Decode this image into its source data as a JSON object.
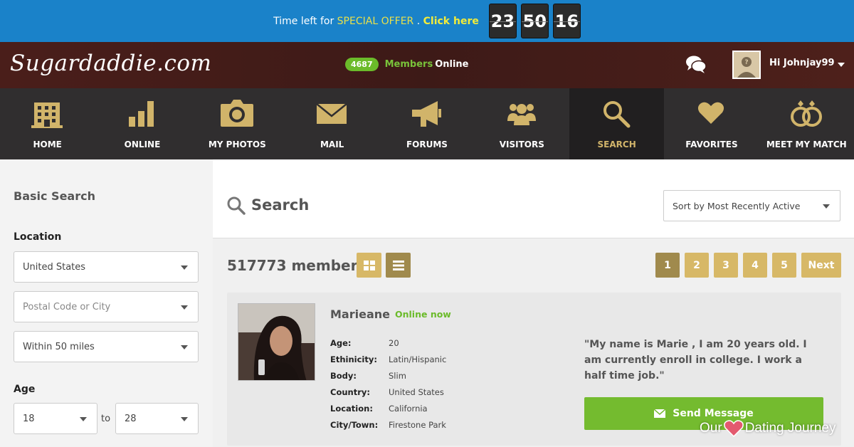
{
  "promo": {
    "prefix": "Time left for",
    "offer": "SPECIAL OFFER",
    "dot": ".",
    "cta": "Click here",
    "countdown": [
      "23",
      "50",
      "16"
    ]
  },
  "header": {
    "logo": "Sugardaddie.com",
    "online_count": "4687",
    "online_members": "Members",
    "online_label": "Online",
    "chat_icon": "chat-bubbles-icon",
    "greeting": "Hi Johnjay99"
  },
  "nav": {
    "items": [
      {
        "label": "HOME",
        "icon": "building-icon"
      },
      {
        "label": "ONLINE",
        "icon": "bar-chart-icon"
      },
      {
        "label": "MY PHOTOS",
        "icon": "camera-icon"
      },
      {
        "label": "MAIL",
        "icon": "envelope-icon"
      },
      {
        "label": "FORUMS",
        "icon": "megaphone-icon"
      },
      {
        "label": "VISITORS",
        "icon": "group-icon"
      },
      {
        "label": "SEARCH",
        "icon": "magnifier-icon",
        "active": true
      },
      {
        "label": "FAVORITES",
        "icon": "heart-icon"
      },
      {
        "label": "MEET MY MATCH",
        "icon": "rings-icon"
      }
    ],
    "accent": "#d1b46a"
  },
  "sidebar": {
    "title": "Basic Search",
    "location_label": "Location",
    "country": "United States",
    "postal_placeholder": "Postal Code or City",
    "distance": "Within 50 miles",
    "age_label": "Age",
    "age_from": "18",
    "age_to_word": "to",
    "age_to": "28"
  },
  "main": {
    "title": "Search",
    "sort": "Sort by Most Recently Active",
    "member_count": "517773 members",
    "pages": [
      "1",
      "2",
      "3",
      "4",
      "5"
    ],
    "next": "Next"
  },
  "profile": {
    "name": "Marieane",
    "status": "Online now",
    "attributes": [
      {
        "key": "Age:",
        "value": "20"
      },
      {
        "key": "Ethinicity:",
        "value": "Latin/Hispanic"
      },
      {
        "key": "Body:",
        "value": "Slim"
      },
      {
        "key": "Country:",
        "value": "United States"
      },
      {
        "key": "Location:",
        "value": "California"
      },
      {
        "key": "City/Town:",
        "value": "Firestone Park"
      }
    ],
    "quote": "\"My name is Marie , I am 20 years old. I am currently enroll in college. I work a half time job.\"",
    "send_label": "Send Message"
  },
  "watermark": {
    "part1": "Our",
    "part2": "Dating Journey"
  },
  "colors": {
    "promo_bg": "#1a82c9",
    "gold": "#d7b867",
    "gold_dark": "#a08a4d",
    "green": "#74bb2f"
  }
}
